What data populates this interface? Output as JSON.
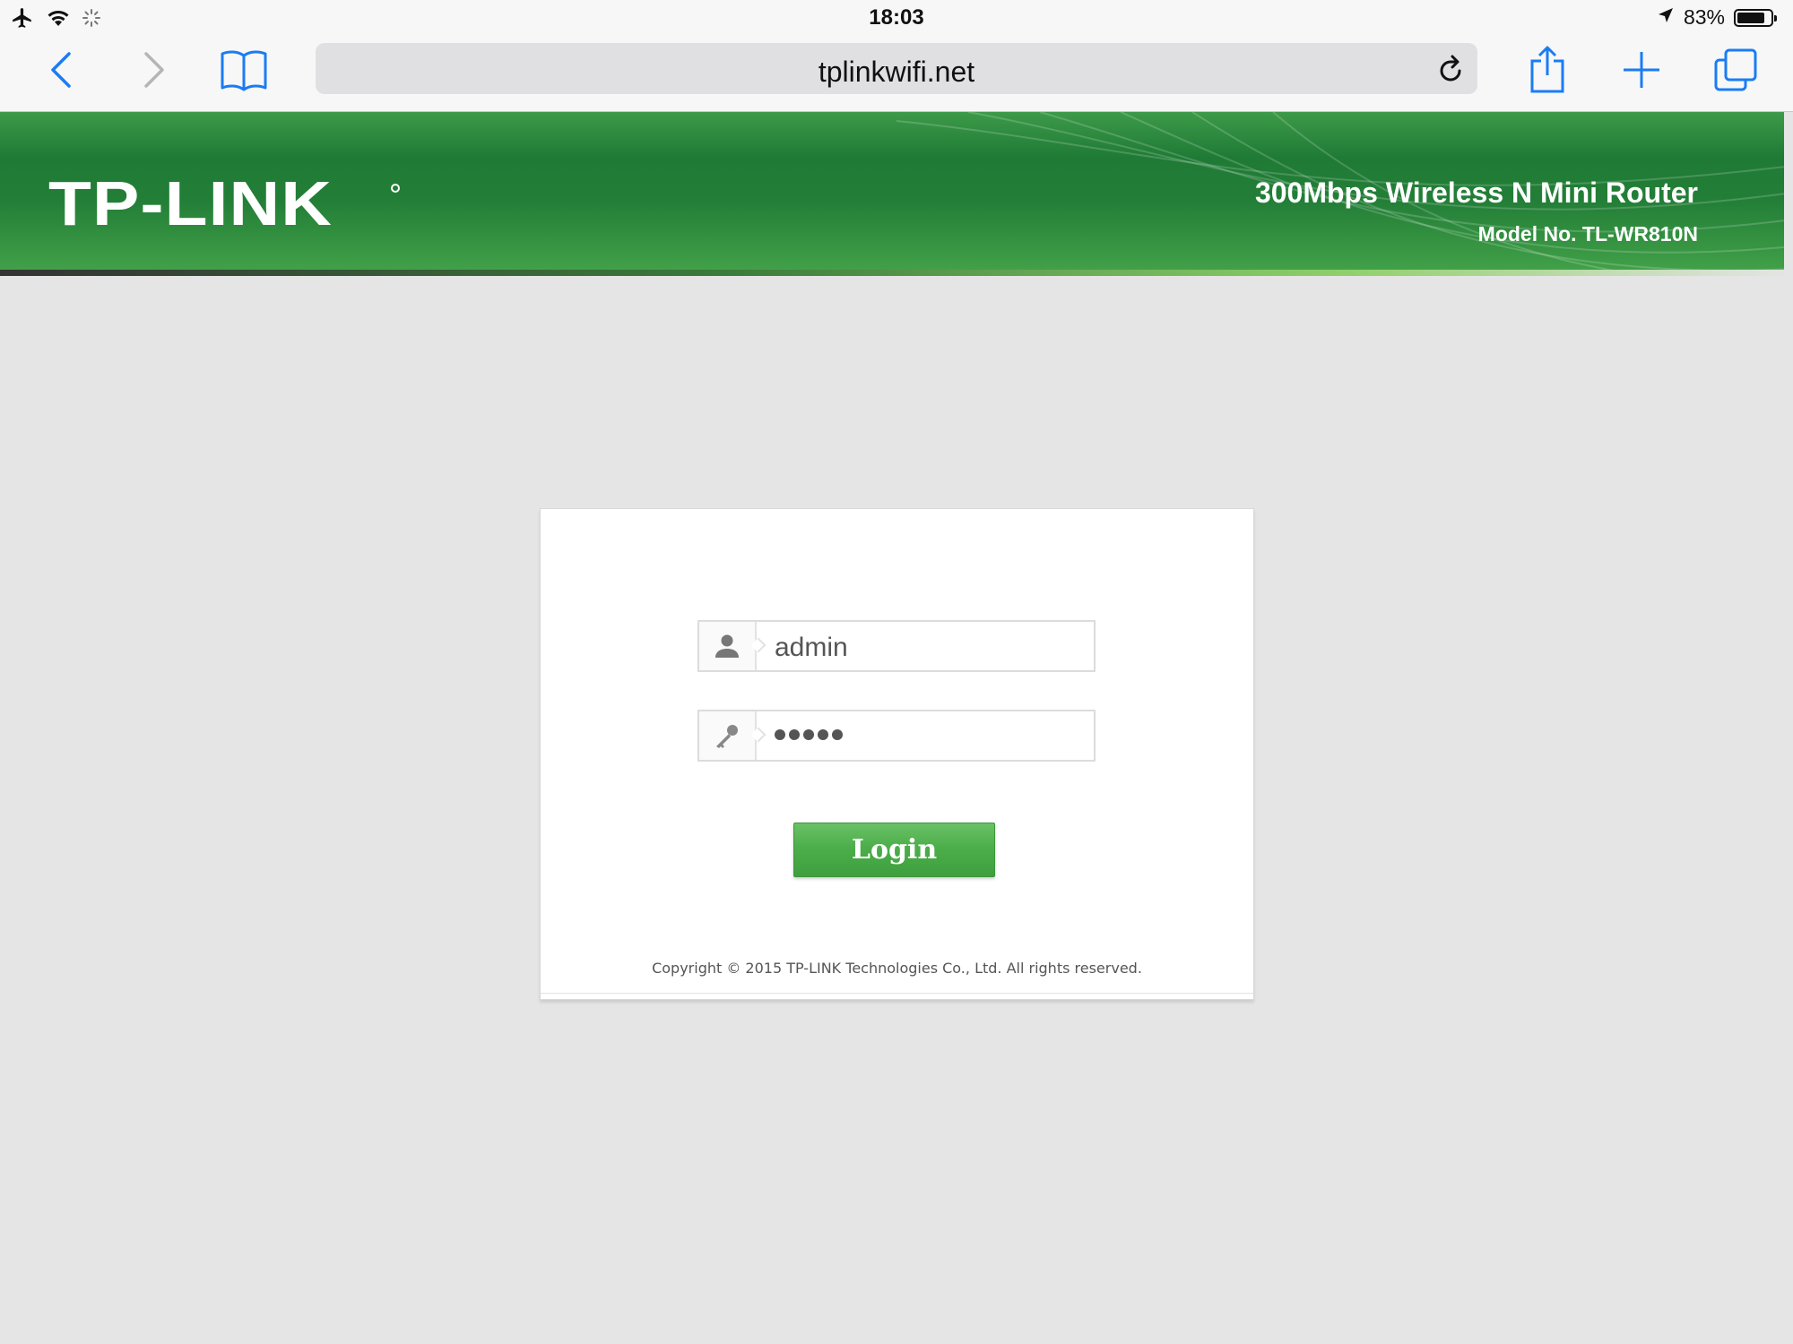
{
  "status_bar": {
    "time": "18:03",
    "battery": "83%",
    "battery_level": 0.83,
    "icons": [
      "airplane-icon",
      "wifi-icon",
      "activity-spinner-icon",
      "location-arrow-icon",
      "battery-icon"
    ]
  },
  "browser": {
    "url": "tplinkwifi.net",
    "buttons": [
      "back",
      "forward",
      "bookmarks",
      "reload",
      "share",
      "new-tab",
      "tabs"
    ],
    "accent_color": "#1a7cf5"
  },
  "header": {
    "logo": "TP-LINK",
    "product": "300Mbps Wireless N Mini Router",
    "model": "Model No. TL-WR810N",
    "brand_color": "#237f37"
  },
  "login": {
    "username": "admin",
    "password_length": 5,
    "button_label": "Login",
    "copyright": "Copyright © 2015 TP-LINK Technologies Co., Ltd. All rights reserved."
  }
}
